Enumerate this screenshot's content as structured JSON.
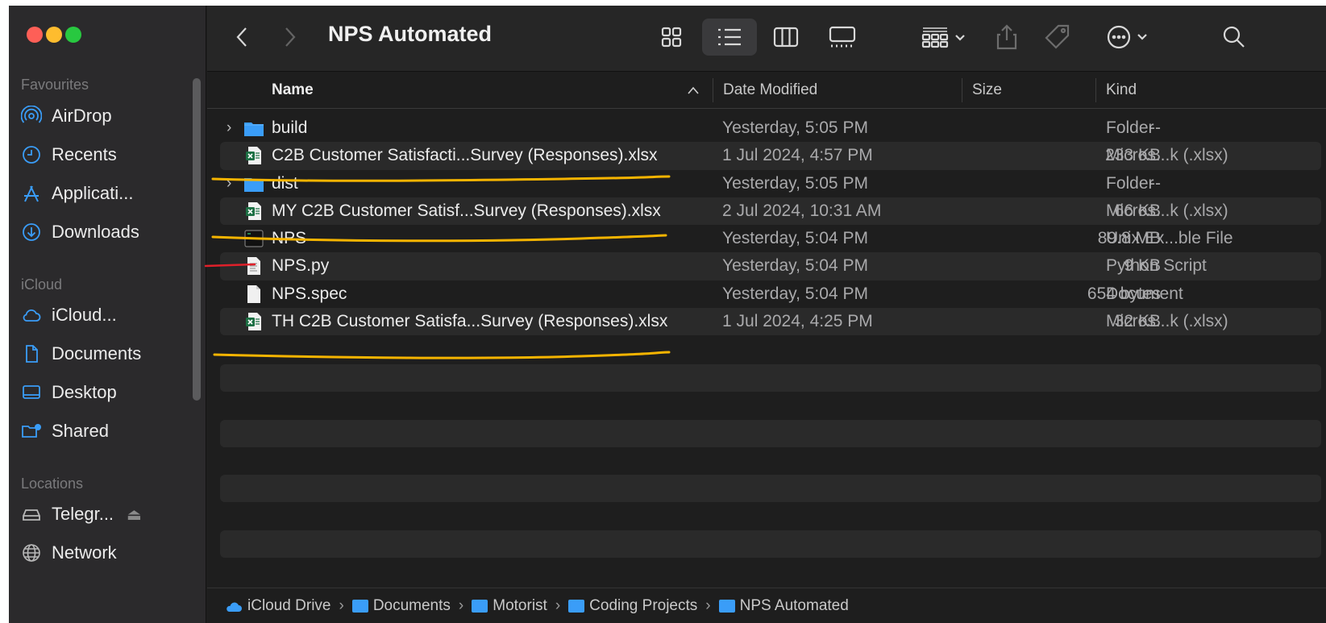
{
  "window": {
    "title": "NPS Automated"
  },
  "sidebar": {
    "sections": [
      {
        "label": "Favourites"
      },
      {
        "label": "iCloud"
      },
      {
        "label": "Locations"
      }
    ],
    "favourites": [
      {
        "label": "AirDrop",
        "icon": "airdrop-icon"
      },
      {
        "label": "Recents",
        "icon": "clock-icon"
      },
      {
        "label": "Applicati...",
        "icon": "applications-icon"
      },
      {
        "label": "Downloads",
        "icon": "download-icon"
      }
    ],
    "icloud": [
      {
        "label": "iCloud...",
        "icon": "cloud-icon"
      },
      {
        "label": "Documents",
        "icon": "document-icon"
      },
      {
        "label": "Desktop",
        "icon": "desktop-icon"
      },
      {
        "label": "Shared",
        "icon": "shared-folder-icon"
      }
    ],
    "locations": [
      {
        "label": "Telegr...",
        "icon": "disk-icon"
      },
      {
        "label": "Network",
        "icon": "globe-icon"
      }
    ]
  },
  "header": {
    "name": "Name",
    "date": "Date Modified",
    "size": "Size",
    "kind": "Kind",
    "sort_indicator": "^"
  },
  "files": [
    {
      "name": "build",
      "date": "Yesterday, 5:05 PM",
      "size": "--",
      "kind": "Folder",
      "type": "folder"
    },
    {
      "name": "C2B Customer Satisfacti...Survey (Responses).xlsx",
      "date": "1 Jul 2024, 4:57 PM",
      "size": "233 KB",
      "kind": "Micros...k (.xlsx)",
      "type": "xlsx"
    },
    {
      "name": "dist",
      "date": "Yesterday, 5:05 PM",
      "size": "--",
      "kind": "Folder",
      "type": "folder"
    },
    {
      "name": "MY C2B Customer Satisf...Survey (Responses).xlsx",
      "date": "2 Jul 2024, 10:31 AM",
      "size": "66 KB",
      "kind": "Micros...k (.xlsx)",
      "type": "xlsx"
    },
    {
      "name": "NPS",
      "date": "Yesterday, 5:04 PM",
      "size": "89.8 MB",
      "kind": "Unix Ex...ble File",
      "type": "exec"
    },
    {
      "name": "NPS.py",
      "date": "Yesterday, 5:04 PM",
      "size": "9 KB",
      "kind": "Python Script",
      "type": "script"
    },
    {
      "name": "NPS.spec",
      "date": "Yesterday, 5:04 PM",
      "size": "654 bytes",
      "kind": "Document",
      "type": "doc"
    },
    {
      "name": "TH C2B Customer Satisfa...Survey (Responses).xlsx",
      "date": "1 Jul 2024, 4:25 PM",
      "size": "32 KB",
      "kind": "Micros...k (.xlsx)",
      "type": "xlsx"
    }
  ],
  "path": [
    {
      "label": "iCloud Drive"
    },
    {
      "label": "Documents"
    },
    {
      "label": "Motorist"
    },
    {
      "label": "Coding Projects"
    },
    {
      "label": "NPS Automated"
    }
  ],
  "colors": {
    "annotation_highlight": "#f5b400",
    "annotation_marker": "#e0202a",
    "accent": "#3a9df8"
  }
}
